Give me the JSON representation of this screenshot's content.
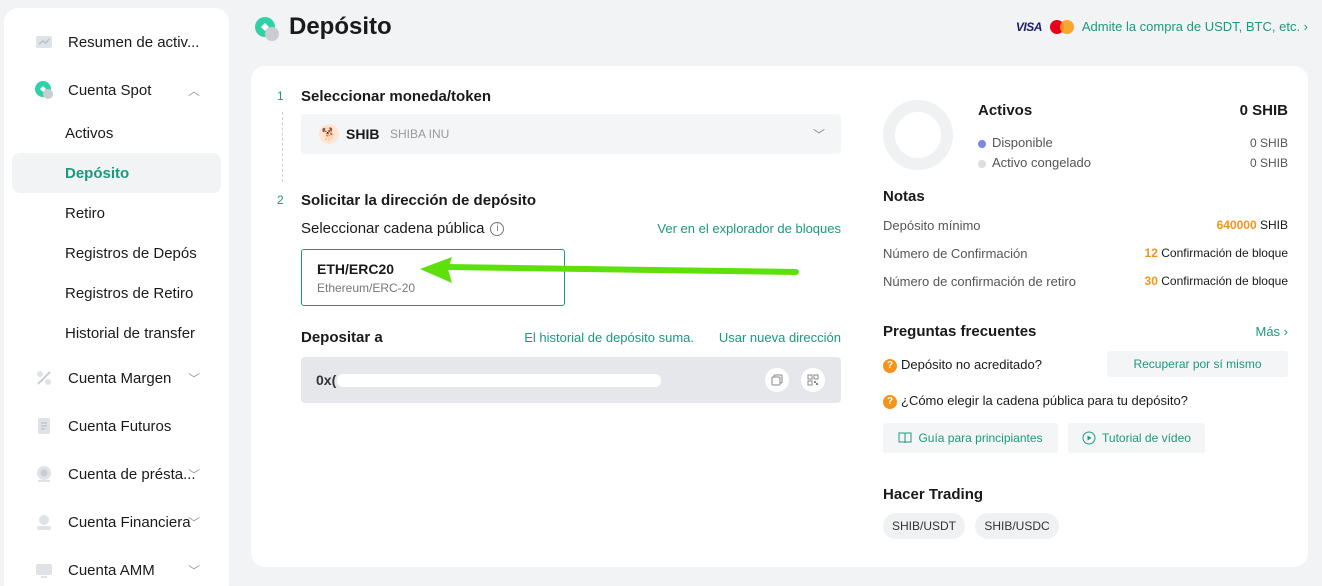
{
  "sidebar": {
    "items": [
      {
        "label": "Resumen de activ..."
      },
      {
        "label": "Cuenta Spot"
      },
      {
        "label": "Cuenta Margen"
      },
      {
        "label": "Cuenta Futuros"
      },
      {
        "label": "Cuenta de présta..."
      },
      {
        "label": "Cuenta Financiera"
      },
      {
        "label": "Cuenta AMM"
      }
    ],
    "spot_sub": [
      {
        "label": "Activos"
      },
      {
        "label": "Depósito"
      },
      {
        "label": "Retiro"
      },
      {
        "label": "Registros de Depósi"
      },
      {
        "label": "Registros de Retiro"
      },
      {
        "label": "Historial de transfer"
      }
    ]
  },
  "header": {
    "title": "Depósito",
    "visa": "VISA",
    "buy_link": "Admite la compra de USDT, BTC, etc. ›"
  },
  "steps": {
    "step1_num": "1",
    "step1_title": "Seleccionar moneda/token",
    "step2_num": "2",
    "step2_title": "Solicitar la dirección de depósito"
  },
  "token": {
    "symbol": "SHIB",
    "name": "SHIBA INU"
  },
  "chain": {
    "label": "Seleccionar cadena pública",
    "explorer_link": "Ver en el explorador de bloques",
    "selected_name": "ETH/ERC20",
    "selected_sub": "Ethereum/ERC-20"
  },
  "deposit": {
    "label": "Depositar a",
    "history_link": "El historial de depósito suma.",
    "new_address_link": "Usar nueva dirección",
    "address_prefix": "0x("
  },
  "assets": {
    "title": "Activos",
    "total": "0 SHIB",
    "available_label": "Disponible",
    "available_value": "0 SHIB",
    "frozen_label": "Activo congelado",
    "frozen_value": "0 SHIB"
  },
  "notes": {
    "title": "Notas",
    "min_label": "Depósito mínimo",
    "min_value": "640000",
    "min_unit": "SHIB",
    "conf_label": "Número de Confirmación",
    "conf_value": "12",
    "conf_unit": "Confirmación de bloque",
    "wconf_label": "Número de confirmación de retiro",
    "wconf_value": "30",
    "wconf_unit": "Confirmación de bloque"
  },
  "faq": {
    "title": "Preguntas frecuentes",
    "more": "Más ›",
    "q1": "Depósito no acreditado?",
    "q1_button": "Recuperar por sí mismo",
    "q2": "¿Cómo elegir la cadena pública para tu depósito?",
    "guide_button": "Guía para principiantes",
    "video_button": "Tutorial de vídeo"
  },
  "trading": {
    "title": "Hacer Trading",
    "pairs": [
      "SHIB/USDT",
      "SHIB/USDC"
    ]
  },
  "colors": {
    "accent": "#1a9a7c",
    "orange": "#f7931a",
    "arrow": "#5ee00a"
  }
}
